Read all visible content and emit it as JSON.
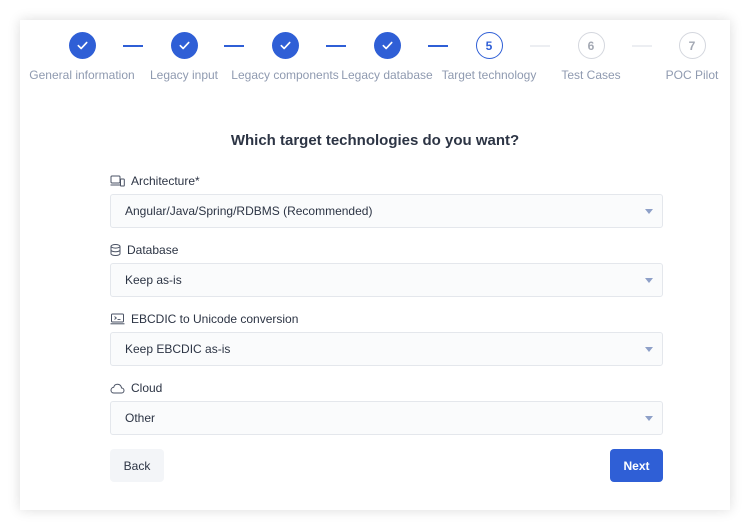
{
  "stepper": {
    "steps": [
      {
        "number": "1",
        "label": "General information",
        "status": "done"
      },
      {
        "number": "2",
        "label": "Legacy input",
        "status": "done"
      },
      {
        "number": "3",
        "label": "Legacy components",
        "status": "done"
      },
      {
        "number": "4",
        "label": "Legacy database",
        "status": "done"
      },
      {
        "number": "5",
        "label": "Target technology",
        "status": "active"
      },
      {
        "number": "6",
        "label": "Test Cases",
        "status": "todo"
      },
      {
        "number": "7",
        "label": "POC Pilot",
        "status": "todo"
      }
    ],
    "done_icon": "check-icon"
  },
  "form": {
    "question": "Which target technologies do you want?",
    "fields": [
      {
        "label": "Architecture*",
        "icon": "devices-icon",
        "value": "Angular/Java/Spring/RDBMS (Recommended)"
      },
      {
        "label": "Database",
        "icon": "database-icon",
        "value": "Keep as-is"
      },
      {
        "label": "EBCDIC to Unicode conversion",
        "icon": "terminal-icon",
        "value": "Keep EBCDIC as-is"
      },
      {
        "label": "Cloud",
        "icon": "cloud-icon",
        "value": "Other"
      }
    ]
  },
  "actions": {
    "back_label": "Back",
    "next_label": "Next"
  },
  "colors": {
    "primary": "#2f5fd6",
    "text": "#2c3444",
    "muted": "#8f9ab0",
    "border": "#e4e7ec"
  }
}
